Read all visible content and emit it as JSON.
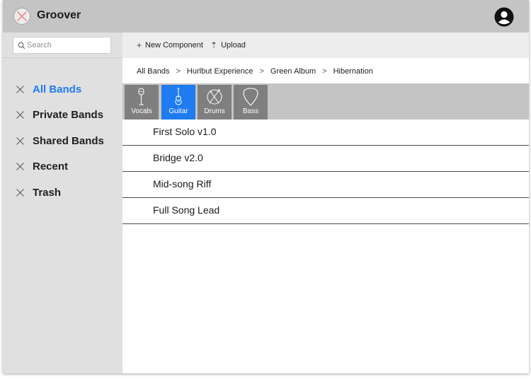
{
  "app": {
    "title": "Groover",
    "logo_icon": "x-circle-logo-icon",
    "account_icon": "user-circle-icon"
  },
  "sidebar": {
    "search": {
      "placeholder": "Search"
    },
    "items": [
      {
        "label": "All Bands",
        "active": true
      },
      {
        "label": "Private Bands",
        "active": false
      },
      {
        "label": "Shared Bands",
        "active": false
      },
      {
        "label": "Recent",
        "active": false
      },
      {
        "label": "Trash",
        "active": false
      }
    ]
  },
  "toolbar": {
    "new_label": "New Component",
    "upload_label": "Upload",
    "new_glyph": "+",
    "upload_glyph": "⇡"
  },
  "breadcrumb": {
    "items": [
      "All Bands",
      "Hurlbut Experience",
      "Green Album",
      "Hibernation"
    ],
    "separator": ">"
  },
  "instruments": [
    {
      "label": "Vocals",
      "icon": "microphone-icon",
      "active": false
    },
    {
      "label": "Guitar",
      "icon": "guitar-icon",
      "active": true
    },
    {
      "label": "Drums",
      "icon": "drum-icon",
      "active": false
    },
    {
      "label": "Bass",
      "icon": "guitar-pick-icon",
      "active": false
    }
  ],
  "components": [
    "First Solo v1.0",
    "Bridge v2.0",
    "Mid-song Riff",
    "Full Song Lead"
  ],
  "colors": {
    "accent": "#1e7bf0",
    "header": "#c4c4c4",
    "sidebar": "#e0e0e0",
    "toolbar": "#ededed",
    "instrument_tab": "#7f7f7f"
  }
}
